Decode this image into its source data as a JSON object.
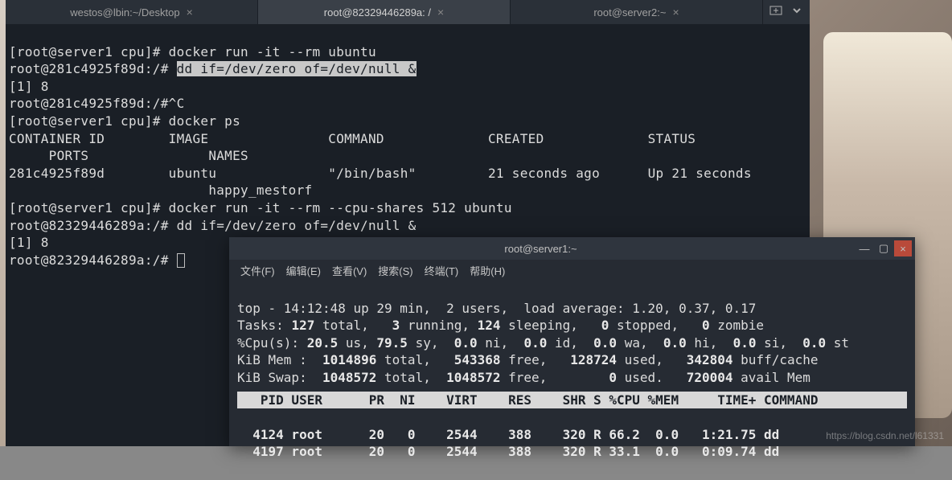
{
  "tabs": [
    {
      "label": "westos@lbin:~/Desktop"
    },
    {
      "label": "root@82329446289a: /"
    },
    {
      "label": "root@server2:~"
    }
  ],
  "term1": {
    "l1_prompt": "[root@server1 cpu]# ",
    "l1_cmd": "docker run -it --rm ubuntu",
    "l2_prompt": "root@281c4925f89d:/# ",
    "l2_cmd": "dd if=/dev/zero of=/dev/null &",
    "l3": "[1] 8",
    "l4": "root@281c4925f89d:/#^C",
    "l5_prompt": "[root@server1 cpu]# ",
    "l5_cmd": "docker ps",
    "l6": "CONTAINER ID        IMAGE               COMMAND             CREATED             STATUS              ",
    "l6b": "     PORTS               NAMES",
    "l7": "281c4925f89d        ubuntu              \"/bin/bash\"         21 seconds ago      Up 21 seconds       ",
    "l7b": "                         happy_mestorf",
    "l8_prompt": "[root@server1 cpu]# ",
    "l8_cmd": "docker run -it --rm --cpu-shares 512 ubuntu",
    "l9": "root@82329446289a:/# dd if=/dev/zero of=/dev/null &",
    "l10": "[1] 8",
    "l11": "root@82329446289a:/# "
  },
  "win2": {
    "title": "root@server1:~",
    "menu": [
      "文件(F)",
      "编辑(E)",
      "查看(V)",
      "搜索(S)",
      "终端(T)",
      "帮助(H)"
    ]
  },
  "top": {
    "l1": "top - 14:12:48 up 29 min,  2 users,  load average: 1.20, 0.37, 0.17",
    "l2a": "Tasks: ",
    "l2b": "127 ",
    "l2c": "total,   ",
    "l2d": "3 ",
    "l2e": "running, ",
    "l2f": "124 ",
    "l2g": "sleeping,   ",
    "l2h": "0 ",
    "l2i": "stopped,   ",
    "l2j": "0 ",
    "l2k": "zombie",
    "l3a": "%Cpu(s): ",
    "l3b": "20.5 ",
    "l3c": "us, ",
    "l3d": "79.5 ",
    "l3e": "sy,  ",
    "l3f": "0.0 ",
    "l3g": "ni,  ",
    "l3h": "0.0 ",
    "l3i": "id,  ",
    "l3j": "0.0 ",
    "l3k": "wa,  ",
    "l3l": "0.0 ",
    "l3m": "hi,  ",
    "l3n": "0.0 ",
    "l3o": "si,  ",
    "l3p": "0.0 ",
    "l3q": "st",
    "l4a": "KiB Mem :  ",
    "l4b": "1014896 ",
    "l4c": "total,   ",
    "l4d": "543368 ",
    "l4e": "free,   ",
    "l4f": "128724 ",
    "l4g": "used,   ",
    "l4h": "342804 ",
    "l4i": "buff/cache",
    "l5a": "KiB Swap:  ",
    "l5b": "1048572 ",
    "l5c": "total,  ",
    "l5d": "1048572 ",
    "l5e": "free,        ",
    "l5f": "0 ",
    "l5g": "used.   ",
    "l5h": "720004 ",
    "l5i": "avail Mem ",
    "hdr": "   PID USER      PR  NI    VIRT    RES    SHR S %CPU %MEM     TIME+ COMMAND     ",
    "r1": "  4124 root      20   0    2544    388    320 R 66.2  0.0   1:21.75 dd          ",
    "r2": "  4197 root      20   0    2544    388    320 R 33.1  0.0   0:09.74 dd          "
  },
  "watermark": "https://blog.csdn.net/l61331"
}
